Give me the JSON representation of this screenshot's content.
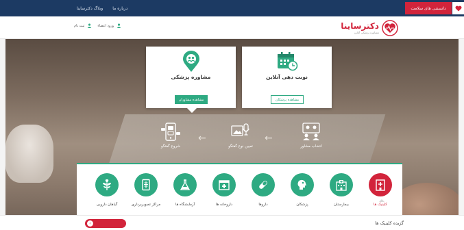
{
  "topbar": {
    "links": [
      "وبلاگ دکترساینا",
      "درباره ما"
    ],
    "health_tab": "دانستنی های سلامت"
  },
  "header": {
    "login": "ورود اعضاء",
    "register": "ثبت نام",
    "logo_name": "دکترساینا",
    "logo_tagline": "مشاوره پزشکی آنلاین"
  },
  "cards": {
    "consult": {
      "title": "مشاوره پزشکی",
      "subtitle": "",
      "button": "مشاهده مشاوران"
    },
    "appointment": {
      "title": "نوبت دهی آنلاین",
      "subtitle": "",
      "button": "مشاهده پزشکان"
    }
  },
  "steps": [
    "انتخاب مشاور",
    "تعیین نوع گفتگو",
    "شروع گفتگو"
  ],
  "categories": [
    {
      "label": "کلینیک ها",
      "icon": "clinic-icon",
      "active": true
    },
    {
      "label": "بیمارستان",
      "icon": "hospital-icon",
      "active": false
    },
    {
      "label": "پزشکان",
      "icon": "doctor-icon",
      "active": false
    },
    {
      "label": "داروها",
      "icon": "pill-icon",
      "active": false
    },
    {
      "label": "داروخانه ها",
      "icon": "pharmacy-icon",
      "active": false
    },
    {
      "label": "آزمایشگاه ها",
      "icon": "flask-icon",
      "active": false
    },
    {
      "label": "مراکز تصویربرداری",
      "icon": "xray-icon",
      "active": false
    },
    {
      "label": "گیاهان دارویی",
      "icon": "herb-icon",
      "active": false
    }
  ],
  "bottom": {
    "heading": "گزیده کلینیک ها",
    "all_button": ""
  },
  "colors": {
    "navy": "#1c3a63",
    "red": "#d2243b",
    "green": "#2eaa82"
  }
}
